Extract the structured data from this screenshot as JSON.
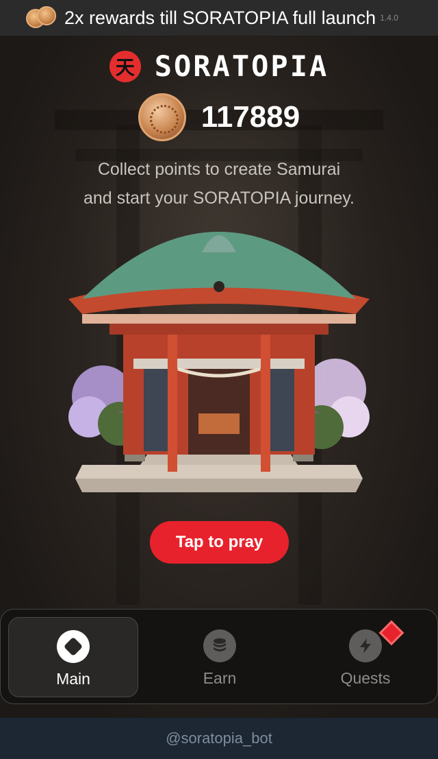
{
  "banner": {
    "text": "2x rewards till SORATOPIA full launch",
    "version": "1.4.0",
    "icon": "coins-icon"
  },
  "header": {
    "logo_mark": "天",
    "logo_text": "SORATOPIA",
    "points": "117889",
    "coin_icon": "coin-icon"
  },
  "tagline": {
    "line1": "Collect points to create Samurai",
    "line2": "and start your SORATOPIA journey."
  },
  "pray_button": {
    "label": "Tap to pray",
    "color": "#e8222c"
  },
  "nav": {
    "items": [
      {
        "label": "Main",
        "icon": "diamond-icon",
        "active": true
      },
      {
        "label": "Earn",
        "icon": "coin-stack-icon",
        "active": false
      },
      {
        "label": "Quests",
        "icon": "lightning-icon",
        "active": false
      }
    ]
  },
  "footer": {
    "handle": "@soratopia_bot"
  },
  "colors": {
    "accent": "#e8222c",
    "footer_bg": "#1c2733",
    "banner_bg": "#2b2b2b"
  }
}
